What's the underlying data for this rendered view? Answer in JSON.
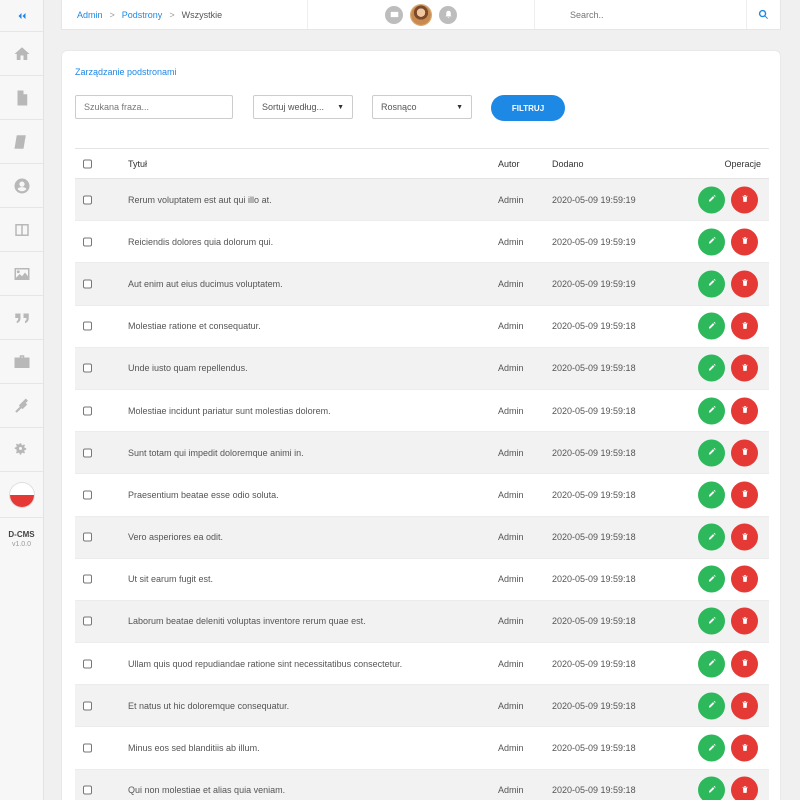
{
  "sidebar": {
    "items": [
      {
        "icon": "home-icon",
        "name": "sidebar-item-home"
      },
      {
        "icon": "file-icon",
        "name": "sidebar-item-pages"
      },
      {
        "icon": "book-icon",
        "name": "sidebar-item-posts"
      },
      {
        "icon": "user-icon",
        "name": "sidebar-item-users"
      },
      {
        "icon": "columns-icon",
        "name": "sidebar-item-layout"
      },
      {
        "icon": "image-icon",
        "name": "sidebar-item-media"
      },
      {
        "icon": "quote-icon",
        "name": "sidebar-item-quotes"
      },
      {
        "icon": "briefcase-icon",
        "name": "sidebar-item-portfolio"
      },
      {
        "icon": "plug-icon",
        "name": "sidebar-item-plugins"
      },
      {
        "icon": "cogs-icon",
        "name": "sidebar-item-settings"
      }
    ],
    "brand_name": "D-CMS",
    "version": "v1.0.0"
  },
  "topbar": {
    "breadcrumb": [
      "Admin",
      "Podstrony",
      "Wszystkie"
    ],
    "separator": ">",
    "search_placeholder": "Search.."
  },
  "panel": {
    "title": "Zarządzanie podstronami",
    "filters": {
      "search_placeholder": "Szukana fraza...",
      "sort_label": "Sortuj według...",
      "order_label": "Rosnąco",
      "button_label": "FILTRUJ"
    }
  },
  "table": {
    "headers": {
      "title": "Tytuł",
      "author": "Autor",
      "date": "Dodano",
      "operations": "Operacje"
    },
    "rows": [
      {
        "title": "Rerum voluptatem est aut qui illo at.",
        "author": "Admin",
        "date": "2020-05-09 19:59:19"
      },
      {
        "title": "Reiciendis dolores quia dolorum qui.",
        "author": "Admin",
        "date": "2020-05-09 19:59:19"
      },
      {
        "title": "Aut enim aut eius ducimus voluptatem.",
        "author": "Admin",
        "date": "2020-05-09 19:59:19"
      },
      {
        "title": "Molestiae ratione et consequatur.",
        "author": "Admin",
        "date": "2020-05-09 19:59:18"
      },
      {
        "title": "Unde iusto quam repellendus.",
        "author": "Admin",
        "date": "2020-05-09 19:59:18"
      },
      {
        "title": "Molestiae incidunt pariatur sunt molestias dolorem.",
        "author": "Admin",
        "date": "2020-05-09 19:59:18"
      },
      {
        "title": "Sunt totam qui impedit doloremque animi in.",
        "author": "Admin",
        "date": "2020-05-09 19:59:18"
      },
      {
        "title": "Praesentium beatae esse odio soluta.",
        "author": "Admin",
        "date": "2020-05-09 19:59:18"
      },
      {
        "title": "Vero asperiores ea odit.",
        "author": "Admin",
        "date": "2020-05-09 19:59:18"
      },
      {
        "title": "Ut sit earum fugit est.",
        "author": "Admin",
        "date": "2020-05-09 19:59:18"
      },
      {
        "title": "Laborum beatae deleniti voluptas inventore rerum quae est.",
        "author": "Admin",
        "date": "2020-05-09 19:59:18"
      },
      {
        "title": "Ullam quis quod repudiandae ratione sint necessitatibus consectetur.",
        "author": "Admin",
        "date": "2020-05-09 19:59:18"
      },
      {
        "title": "Et natus ut hic doloremque consequatur.",
        "author": "Admin",
        "date": "2020-05-09 19:59:18"
      },
      {
        "title": "Minus eos sed blanditiis ab illum.",
        "author": "Admin",
        "date": "2020-05-09 19:59:18"
      },
      {
        "title": "Qui non molestiae et alias quia veniam.",
        "author": "Admin",
        "date": "2020-05-09 19:59:18"
      }
    ]
  },
  "colors": {
    "accent": "#1e88e5",
    "edit": "#2eb85c",
    "delete": "#e53935"
  }
}
